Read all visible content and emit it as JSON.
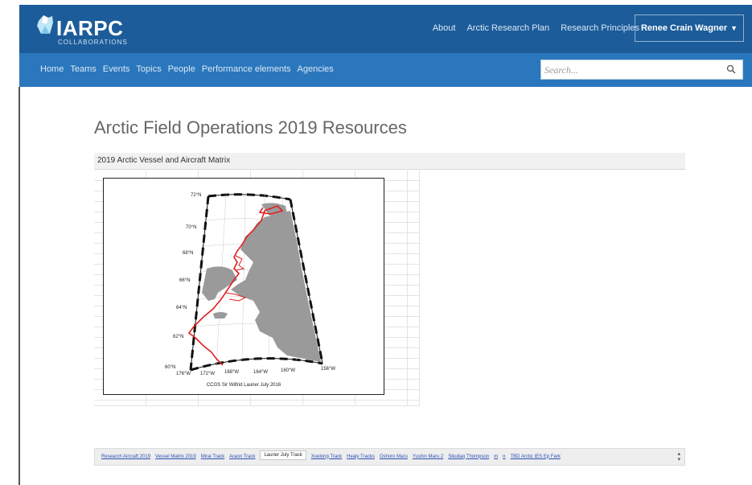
{
  "brand": {
    "name": "IARPC",
    "tagline": "COLLABORATIONS"
  },
  "header": {
    "links": [
      "About",
      "Arctic Research Plan",
      "Research Principles"
    ],
    "user_menu": "Renee Crain Wagner"
  },
  "nav": {
    "items": [
      "Home",
      "Teams",
      "Events",
      "Topics",
      "People",
      "Performance elements",
      "Agencies"
    ],
    "search_placeholder": "Search..."
  },
  "page": {
    "title": "Arctic Field Operations 2019 Resources",
    "embed_title": "2019 Arctic Vessel and Aircraft Matrix"
  },
  "map": {
    "caption": "CCGS Sir Wilfrid Laurier July 2016",
    "lat_labels": [
      "72°N",
      "70°N",
      "68°N",
      "66°N",
      "64°N",
      "62°N",
      "60°N"
    ],
    "lon_labels": [
      "176°W",
      "172°W",
      "168°W",
      "164°W",
      "160°W",
      "156°W"
    ]
  },
  "sheet_tabs": {
    "items": [
      "Research Aircraft 2019",
      "Vessel Matrix 2019",
      "Mirai Track",
      "Araon Track",
      "Laurier July Track",
      "Xuelong Track",
      "Healy Tracks",
      "Oshoro Maru",
      "Yushin Maru 2",
      "Sikuliaq Thompson",
      "m",
      "n",
      "TBD Arctic IES Ep Fark"
    ],
    "active_index": 4
  },
  "colors": {
    "topbar": "#1c5c9a",
    "navbar": "#2a77bd",
    "track": "#e02020",
    "land": "#9a9a9a"
  }
}
